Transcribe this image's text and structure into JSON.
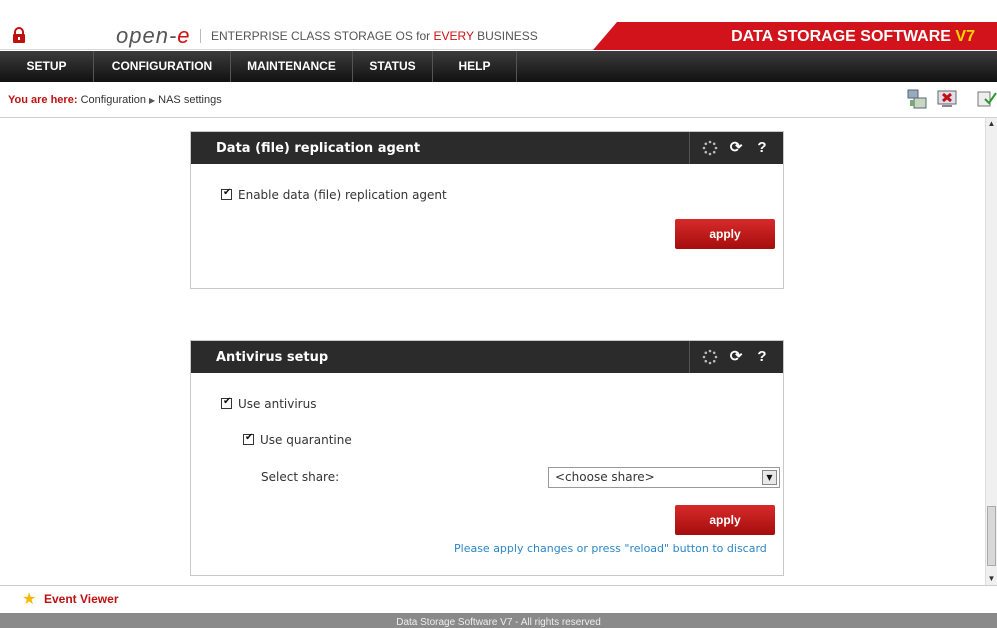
{
  "header": {
    "logo_text": "open-",
    "logo_e": "e",
    "tagline_prefix": "ENTERPRISE CLASS STORAGE OS for",
    "tagline_highlight": "EVERY",
    "tagline_suffix": "BUSINESS",
    "brand": "DATA STORAGE SOFTWARE",
    "brand_version": "V7"
  },
  "nav": [
    "SETUP",
    "CONFIGURATION",
    "MAINTENANCE",
    "STATUS",
    "HELP"
  ],
  "breadcrumb": {
    "lead": "You are here:",
    "path": [
      "Configuration",
      "NAS settings"
    ]
  },
  "panels": {
    "replication": {
      "title": "Data (file) replication agent",
      "checkbox_label": "Enable data (file) replication agent",
      "checked": true,
      "apply_label": "apply"
    },
    "antivirus": {
      "title": "Antivirus setup",
      "use_antivirus_label": "Use antivirus",
      "use_quarantine_label": "Use quarantine",
      "select_share_label": "Select share:",
      "select_value": "<choose share>",
      "apply_label": "apply",
      "hint": "Please apply changes or press \"reload\" button to discard"
    }
  },
  "panel_tool_icons": [
    "spinner-icon",
    "reload-icon",
    "help-icon"
  ],
  "footer": {
    "event_viewer": "Event Viewer",
    "copyright": "Data Storage Software V7 - All rights reserved"
  },
  "colors": {
    "brand_red": "#d3131c",
    "nav_dark": "#1a1a1a",
    "panel_head": "#2b2b2b",
    "hint_blue": "#2b86c6",
    "version_yellow": "#ffd800"
  }
}
